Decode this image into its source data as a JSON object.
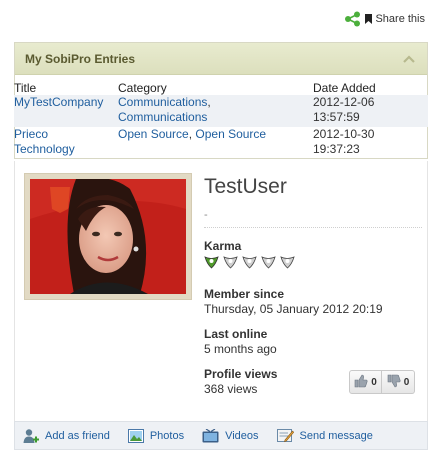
{
  "share": {
    "label": "Share this",
    "icon": "share-icon"
  },
  "module": {
    "title": "My SobiPro Entries",
    "columns": [
      "Title",
      "Category",
      "Date Added"
    ],
    "rows": [
      {
        "title": "MyTestCompany",
        "category": "Communications, Communications",
        "category_a": "Communications",
        "category_b": "Communications",
        "date": "2012-12-06",
        "time": "13:57:59"
      },
      {
        "title_1": "Prieco",
        "title_2": "Technology",
        "category_a": "Open Source",
        "category_b": "Open Source",
        "date": "2012-10-30",
        "time": "19:37:23"
      }
    ]
  },
  "profile": {
    "name": "TestUser",
    "status": "-",
    "karma_label": "Karma",
    "karma_level": 1,
    "karma_max": 5,
    "member_since_label": "Member since",
    "member_since_value": "Thursday, 05 January 2012 20:19",
    "last_online_label": "Last online",
    "last_online_value": "5 months ago",
    "profile_views_label": "Profile views",
    "profile_views_value": "368 views",
    "likes": "0",
    "dislikes": "0"
  },
  "actions": [
    {
      "label": "Add as friend",
      "icon": "add-friend-icon"
    },
    {
      "label": "Photos",
      "icon": "photos-icon"
    },
    {
      "label": "Videos",
      "icon": "videos-icon"
    },
    {
      "label": "Send message",
      "icon": "send-message-icon"
    }
  ],
  "colors": {
    "link": "#1f5e9e",
    "module_header": "#e3e6c5",
    "row_highlight": "#eef1f5",
    "karma_active": "#5aa02c"
  }
}
